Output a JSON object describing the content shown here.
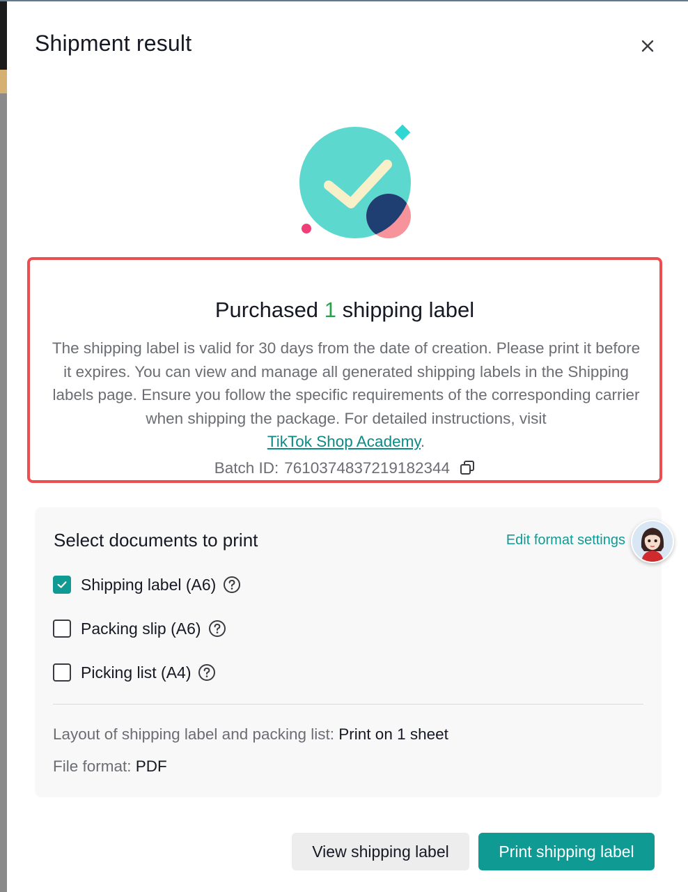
{
  "modal": {
    "title": "Shipment result",
    "close_icon": "close-icon"
  },
  "result": {
    "heading_prefix": "Purchased",
    "heading_count": "1",
    "heading_suffix": "shipping label",
    "body_text": "The shipping label is valid for 30 days from the date of creation. Please print it before it expires. You can view and manage all generated shipping labels in the Shipping labels page. Ensure you follow the specific requirements of the corresponding carrier when shipping the package. For detailed instructions, visit",
    "link_text": "TikTok Shop Academy",
    "link_suffix": ".",
    "batch_label": "Batch ID:",
    "batch_value": "7610374837219182344",
    "copy_icon": "copy-icon",
    "count_color": "#27a24b",
    "highlight_border_color": "#ee4d4f"
  },
  "documents": {
    "title": "Select documents to print",
    "edit_link": "Edit format settings",
    "options": [
      {
        "label": "Shipping label (A6)",
        "checked": true,
        "help_icon": "question-circle-icon"
      },
      {
        "label": "Packing slip (A6)",
        "checked": false,
        "help_icon": "question-circle-icon"
      },
      {
        "label": "Picking list (A4)",
        "checked": false,
        "help_icon": "question-circle-icon"
      }
    ],
    "layout_label": "Layout of shipping label and packing list:",
    "layout_value": "Print on 1 sheet",
    "format_label": "File format:",
    "format_value": "PDF"
  },
  "actions": {
    "view_label": "View shipping label",
    "print_label": "Print shipping label",
    "accent_color": "#0f9a94"
  }
}
